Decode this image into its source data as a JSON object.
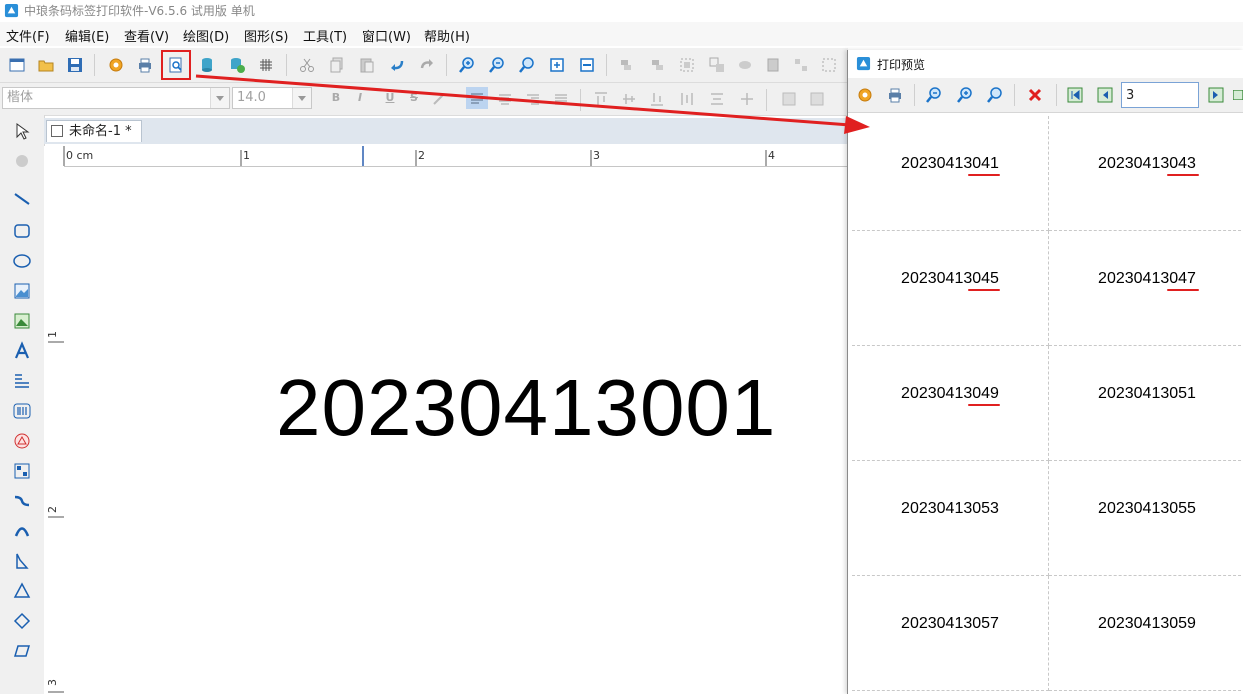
{
  "window": {
    "title": "中琅条码标签打印软件-V6.5.6 试用版 单机"
  },
  "menu": [
    "文件(F)",
    "编辑(E)",
    "查看(V)",
    "绘图(D)",
    "图形(S)",
    "工具(T)",
    "窗口(W)",
    "帮助(H)"
  ],
  "font": {
    "name": "楷体",
    "size": "14.0"
  },
  "format_buttons": {
    "bold": "B",
    "italic": "I",
    "underline": "U",
    "strike": "S"
  },
  "document": {
    "tab_label": "未命名-1 *",
    "ruler_unit_label": "0 cm",
    "ruler_h_marks": [
      "1",
      "2",
      "3",
      "4"
    ],
    "ruler_v_marks": [
      "1",
      "2",
      "3"
    ],
    "label_text": "20230413001"
  },
  "preview": {
    "title": "打印预览",
    "page": "3",
    "labels": [
      "20230413041",
      "20230413043",
      "20230413045",
      "20230413047",
      "20230413049",
      "20230413051",
      "20230413053",
      "20230413055",
      "20230413057",
      "20230413059"
    ],
    "underlined": [
      true,
      true,
      true,
      true,
      true,
      false,
      false,
      false,
      false,
      false
    ]
  },
  "colors": {
    "highlight": "#e02020",
    "accent": "#1a73c9"
  },
  "icons": {
    "toolbar": [
      "new-icon",
      "open-icon",
      "save-icon",
      "settings-icon",
      "print-icon",
      "print-preview-icon",
      "database-icon",
      "database-link-icon",
      "grid-icon",
      "cut-icon",
      "copy-icon",
      "paste-icon",
      "undo-icon",
      "redo-icon",
      "zoom-in-icon",
      "zoom-out-icon",
      "zoom-fit-icon",
      "fit-page-icon",
      "fit-width-icon"
    ],
    "toolbox": [
      "select-icon",
      "rotate-icon",
      "line-icon",
      "rounded-rect-icon",
      "ellipse-icon",
      "image-icon",
      "picture-icon",
      "text-icon",
      "rich-text-icon",
      "barcode-icon",
      "shape-icon",
      "qrcode-icon",
      "curve-icon",
      "arc-icon",
      "polygon-icon",
      "triangle-icon",
      "diamond-icon",
      "parallelogram-icon"
    ]
  }
}
